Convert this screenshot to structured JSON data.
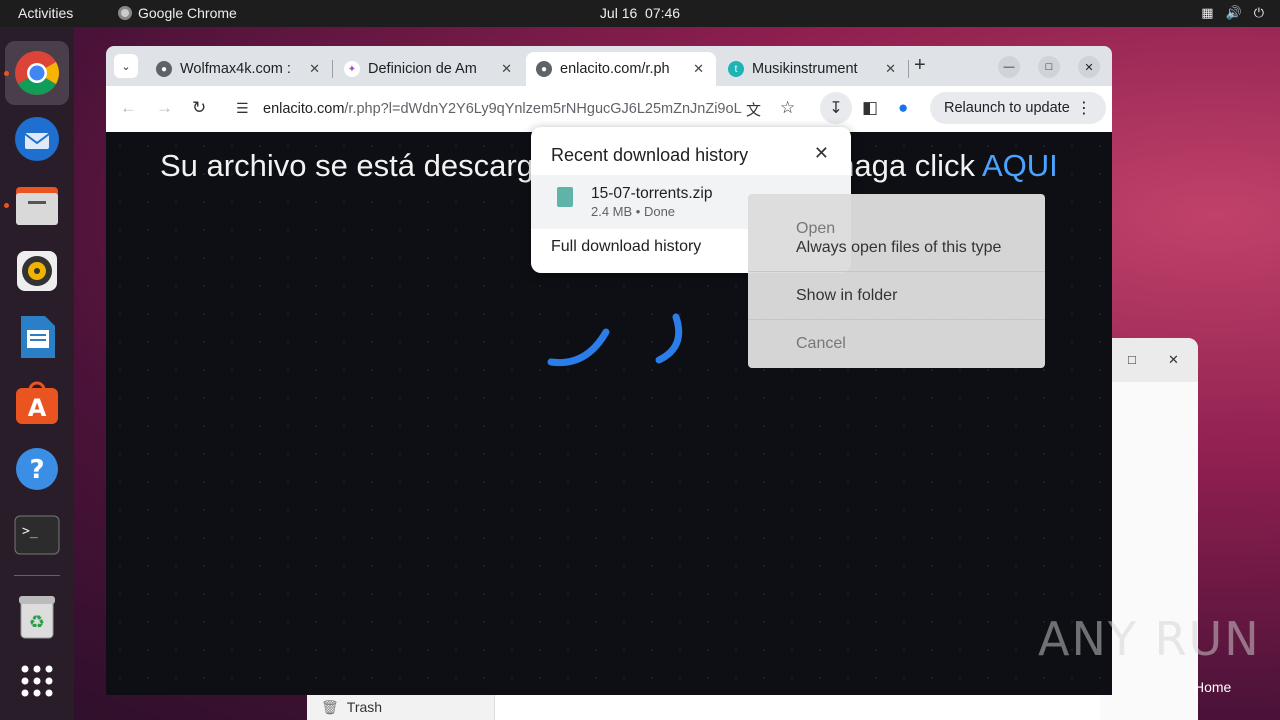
{
  "topbar": {
    "activities": "Activities",
    "app_name": "Google Chrome",
    "date": "Jul 16",
    "time": "07:46",
    "tray_icons": [
      "network-icon",
      "volume-icon",
      "power-icon"
    ]
  },
  "dock": {
    "items": [
      "chrome-icon",
      "thunderbird-icon",
      "files-icon",
      "rhythmbox-icon",
      "writer-icon",
      "app-center-icon",
      "help-icon",
      "terminal-icon",
      "trash-icon",
      "app-grid-icon"
    ]
  },
  "chrome": {
    "tabs": [
      {
        "title": "Wolfmax4k.com :"
      },
      {
        "title": "Definicion de Am"
      },
      {
        "title": "enlacito.com/r.ph"
      },
      {
        "title": "Musikinstrument"
      }
    ],
    "url_host": "enlacito.com",
    "url_rest": "/r.php?l=dWdnY2Y6Ly9qYnlzem5rNHgucGJ6L25mZnJnZi9oL...",
    "relaunch_label": "Relaunch to update"
  },
  "page": {
    "headline_left": "Su archivo se está descarga",
    "headline_right": "haga click ",
    "headline_link": "AQUI"
  },
  "download_popup": {
    "title": "Recent download history",
    "file_name": "15-07-torrents.zip",
    "file_meta": "2.4 MB • Done",
    "full_history": "Full download history"
  },
  "context_menu": {
    "items": [
      {
        "label": "Open"
      },
      {
        "label": "Always open files of this type"
      },
      {
        "label": "Show in folder"
      },
      {
        "label": "Cancel"
      }
    ]
  },
  "background": {
    "files_sidebar_item": "Trash",
    "desktop_label": "Home"
  },
  "watermark": "ANY RUN"
}
